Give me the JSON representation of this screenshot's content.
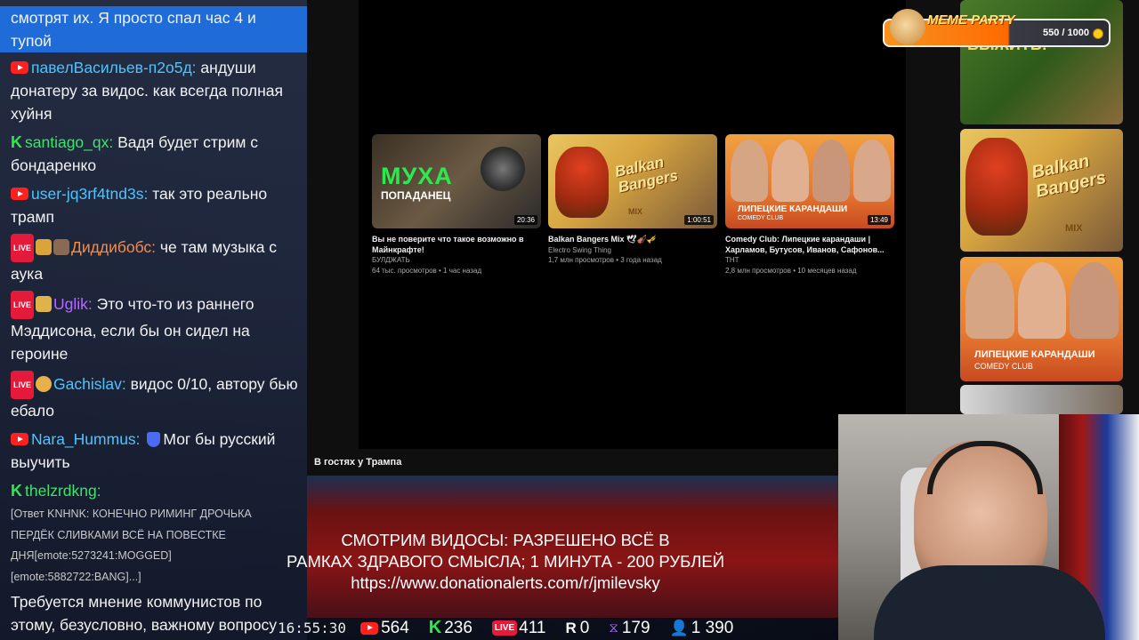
{
  "chat": {
    "messages": [
      {
        "text": "смотрят их. Я просто спал час 4 и тупой"
      },
      {
        "platform": "youtube",
        "user": "павелВасильев-п2о5д:",
        "text": "андуши донатеру за видос. как всегда полная хуйня"
      },
      {
        "platform": "kick",
        "user": "santiago_qx:",
        "text": "Вадя будет стрим с бондаренко"
      },
      {
        "platform": "youtube",
        "user": "user-jq3rf4tnd3s:",
        "text": "так это реально трамп"
      },
      {
        "platform": "live",
        "user": "Диддибобс:",
        "text": "че там музыка с аука"
      },
      {
        "platform": "live",
        "user": "Uglik:",
        "text": "Это что-то из раннего Мэддисона, если бы он сидел на героине"
      },
      {
        "platform": "live",
        "user": "Gachislav:",
        "text": "видос 0/10, автору бью ебало"
      },
      {
        "platform": "youtube",
        "user": "Nara_Hummus:",
        "text": "Мог бы русский выучить"
      },
      {
        "platform": "kick",
        "user": "thelzrdkng:",
        "text": ""
      }
    ],
    "reply_lines": [
      "[Ответ KNHNK: КОНЕЧНО РИМИНГ ДРОЧЬКА",
      "ПЕРДЁК СЛИВКАМИ ВСЁ НА ПОВЕСТКЕ",
      "ДНЯ[emote:5273241:MOGGED]",
      "[emote:5882722:BANG]...]"
    ],
    "last_message": "Требуется мнение коммунистов по этому, безусловно, важному вопросу"
  },
  "player": {
    "title": "В гостях у Трампа",
    "cards": [
      {
        "thumb_label": "МУХА",
        "thumb_sub": "ПОПАДАНЕЦ",
        "duration": "20:36",
        "title": "Вы не поверите что такое возможно в Майнкрафте!",
        "channel": "БУЛДЖАТЬ",
        "meta": "64 тыс. просмотров • 1 час назад"
      },
      {
        "thumb_label": "Balkan Bangers",
        "thumb_sub": "MIX",
        "duration": "1:00:51",
        "title": "Balkan Bangers Mix 🕊🎻🎺",
        "channel": "Electro Swing Thing",
        "meta": "1,7 млн просмотров • 3 года назад"
      },
      {
        "thumb_label": "ЛИПЕЦКИЕ КАРАНДАШИ",
        "thumb_sub": "COMEDY CLUB",
        "duration": "13:49",
        "title": "Comedy Club: Липецкие карандаши | Харламов, Бутусов, Иванов, Сафонов...",
        "channel": "ТНТ",
        "meta": "2,8 млн просмотров • 10 месяцев назад"
      }
    ]
  },
  "sidebar": {
    "thumbs": [
      {
        "label": "ВЫЖИТЬ!"
      },
      {
        "label": "Balkan Bangers",
        "sub": "MIX"
      },
      {
        "label": "ЛИПЕЦКИЕ КАРАНДАШИ",
        "sub": "COMEDY CLUB"
      }
    ]
  },
  "meme_party": {
    "title": "MEME PARTY",
    "count": "550 / 1000"
  },
  "banner": {
    "line1": "СМОТРИМ ВИДОСЫ: РАЗРЕШЕНО ВСЁ В",
    "line2": "РАМКАХ ЗДРАВОГО СМЫСЛА; 1 МИНУТА - 200 РУБЛЕЙ",
    "line3": "https://www.donationalerts.com/r/jmilevsky"
  },
  "status": {
    "time": "16:55:30",
    "youtube": "564",
    "kick": "236",
    "live": "411",
    "rumble": "0",
    "other": "179",
    "total": "1 390"
  },
  "colors": {
    "youtube": "#ff2020",
    "kick": "#2ee84f",
    "live": "#e51a3a",
    "chat_highlight": "#1f6cd8"
  }
}
